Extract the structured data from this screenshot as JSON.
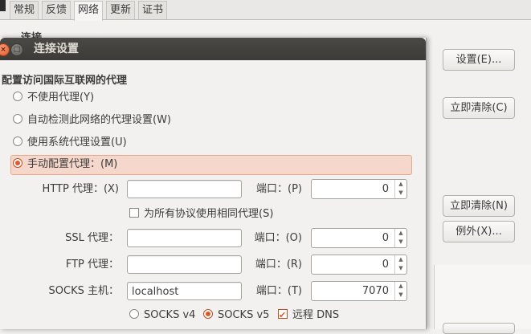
{
  "parent": {
    "tabs": [
      "常规",
      "反馈",
      "网络",
      "更新",
      "证书"
    ],
    "active_tab": "网络",
    "section_partial": "连接",
    "buttons": {
      "settings": "设置(E)...",
      "clear_now_1": "立即清除(C)",
      "clear_now_2": "立即清除(N)",
      "exceptions": "例外(X)..."
    }
  },
  "dialog": {
    "title": "连接设置",
    "close_glyph": "×",
    "min_glyph": "□",
    "section": "配置访问国际互联网的代理",
    "options": [
      {
        "label": "不使用代理(Y)",
        "selected": false
      },
      {
        "label": "自动检测此网络的代理设置(W)",
        "selected": false
      },
      {
        "label": "使用系统代理设置(U)",
        "selected": false
      },
      {
        "label": "手动配置代理：(M)",
        "selected": true
      }
    ],
    "http": {
      "label": "HTTP 代理：(X)",
      "host": "",
      "port_label": "端口：(P)",
      "port": "0"
    },
    "same_proxy": {
      "label": "为所有协议使用相同代理(S)",
      "checked": false
    },
    "ssl": {
      "label": "SSL 代理：",
      "host": "",
      "port_label": "端口：(O)",
      "port": "0"
    },
    "ftp": {
      "label": "FTP 代理：",
      "host": "",
      "port_label": "端口：(R)",
      "port": "0"
    },
    "socks": {
      "label": "SOCKS 主机：",
      "host": "localhost",
      "port_label": "端口：(T)",
      "port": "7070"
    },
    "socks_v4": {
      "label": "SOCKS v4",
      "selected": false
    },
    "socks_v5": {
      "label": "SOCKS v5",
      "selected": true
    },
    "remote_dns": {
      "label": "远程 DNS",
      "checked": true
    }
  },
  "colors": {
    "accent": "#e05a28",
    "titlebar": "#3c3b37",
    "selected_row": "#f6d7cb"
  }
}
